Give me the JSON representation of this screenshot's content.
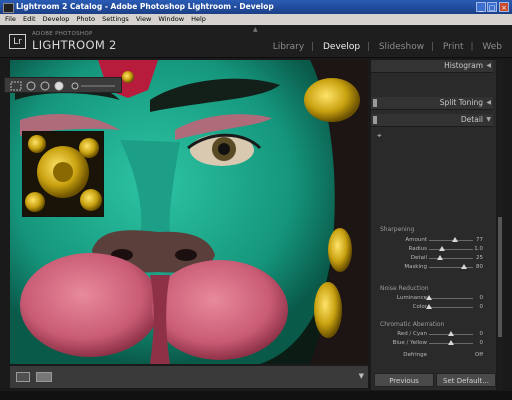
{
  "window": {
    "title": "Lightroom 2 Catalog - Adobe Photoshop Lightroom - Develop",
    "controls": {
      "minimize": "_",
      "maximize": "□",
      "close": "×"
    }
  },
  "menu": [
    "File",
    "Edit",
    "Develop",
    "Photo",
    "Settings",
    "View",
    "Window",
    "Help"
  ],
  "branding": {
    "top": "ADOBE PHOTOSHOP",
    "main": "LIGHTROOM 2",
    "logo": "Lr"
  },
  "modules": {
    "library": "Library",
    "develop": "Develop",
    "slideshow": "Slideshow",
    "print": "Print",
    "web": "Web",
    "separator": "|"
  },
  "panels": {
    "histogram": {
      "label": "Histogram",
      "arrow": "◀"
    },
    "split_toning": {
      "label": "Split Toning",
      "arrow": "◀"
    },
    "detail": {
      "label": "Detail",
      "arrow": "▼"
    }
  },
  "sharpening": {
    "title": "Sharpening",
    "rows": [
      {
        "label": "Amount",
        "value": "77",
        "level": 0.6
      },
      {
        "label": "Radius",
        "value": "1.0",
        "level": 0.3
      },
      {
        "label": "Detail",
        "value": "25",
        "level": 0.25
      },
      {
        "label": "Masking",
        "value": "80",
        "level": 0.8
      }
    ]
  },
  "noise_reduction": {
    "title": "Noise Reduction",
    "rows": [
      {
        "label": "Luminance",
        "value": "0",
        "level": 0
      },
      {
        "label": "Color",
        "value": "0",
        "level": 0
      }
    ]
  },
  "chromatic": {
    "title": "Chromatic Aberration",
    "rows": [
      {
        "label": "Red / Cyan",
        "value": "0",
        "level": 0.5
      },
      {
        "label": "Blue / Yellow",
        "value": "0",
        "level": 0.5
      }
    ],
    "defringe_label": "Defringe",
    "defringe_value": "Off"
  },
  "buttons": {
    "previous": "Previous",
    "reset": "Set Default..."
  },
  "colors": {
    "accent_blue": "#2a5bb5",
    "panel_bg": "#2a2a2a",
    "face_teal": "#1fa78e",
    "muzzle_pink": "#c95c75",
    "gold": "#c9a210"
  }
}
